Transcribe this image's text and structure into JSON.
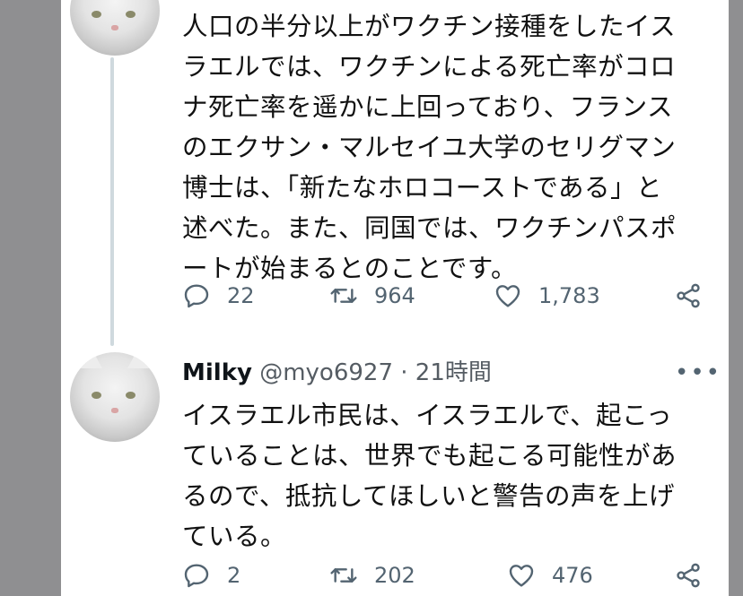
{
  "tweets": [
    {
      "lines": [
        "人口の半分以上がワクチン接種をしたイス",
        "ラエルでは、ワクチンによる死亡率がコロ",
        "ナ死亡率を遥かに上回っており、フランス",
        "のエクサン・マルセイユ大学のセリグマン",
        "博士は、「新たなホロコーストである」と",
        "述べた。また、同国では、ワクチンパスポ",
        "ートが始まるとのことです。"
      ],
      "replies": "22",
      "retweets": "964",
      "likes": "1,783"
    },
    {
      "author_name": "Milky",
      "handle": "@myo6927",
      "separator": "·",
      "time": "21時間",
      "more": "•••",
      "lines": [
        "イスラエル市民は、イスラエルで、起こっ",
        "ていることは、世界でも起こる可能性があ",
        "るので、抵抗してほしいと警告の声を上げ",
        "ている。"
      ],
      "replies": "2",
      "retweets": "202",
      "likes": "476"
    }
  ],
  "icons": {
    "reply": "reply-icon",
    "retweet": "retweet-icon",
    "like": "heart-icon",
    "share": "share-icon"
  },
  "colors": {
    "text": "#111111",
    "secondary": "#536471",
    "thread_line": "#cfd9de",
    "outer_background": "#8f8f91"
  }
}
